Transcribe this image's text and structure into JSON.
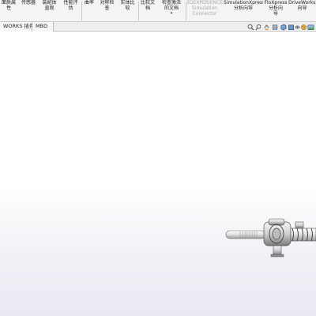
{
  "ribbon": {
    "items": [
      {
        "l1": "面质属",
        "l2": "性",
        "l3": ""
      },
      {
        "l1": "传感器",
        "l2": "",
        "l3": ""
      },
      {
        "l1": "装配体",
        "l2": "直观",
        "l3": ""
      },
      {
        "l1": "性能评",
        "l2": "估",
        "l3": ""
      },
      {
        "l1": "曲率",
        "l2": "",
        "l3": ""
      },
      {
        "l1": "对称检",
        "l2": "查",
        "l3": ""
      },
      {
        "l1": "实体比",
        "l2": "较",
        "l3": ""
      },
      {
        "l1": "比较文",
        "l2": "档",
        "l3": ""
      },
      {
        "l1": "检查激活",
        "l2": "的文档",
        "l3": ""
      },
      {
        "l1": "3DEXPERIENCE",
        "l2": "Simulation",
        "l3": "Connector"
      },
      {
        "l1": "SimulationXpress",
        "l2": "分析向导",
        "l3": ""
      },
      {
        "l1": "FloXpress",
        "l2": "分析向",
        "l3": "导"
      },
      {
        "l1": "DriveWorksX",
        "l2": "向导",
        "l3": ""
      }
    ]
  },
  "tabs": [
    "WORKS 插件",
    "MBD"
  ],
  "hud_icons": [
    "search-icon",
    "zoom-area-icon",
    "previous-view-icon",
    "section-view-icon",
    "view-orientation-icon",
    "display-style-icon",
    "hide-show-icon",
    "appearance-icon",
    "scene-icon",
    "view-settings-icon"
  ]
}
